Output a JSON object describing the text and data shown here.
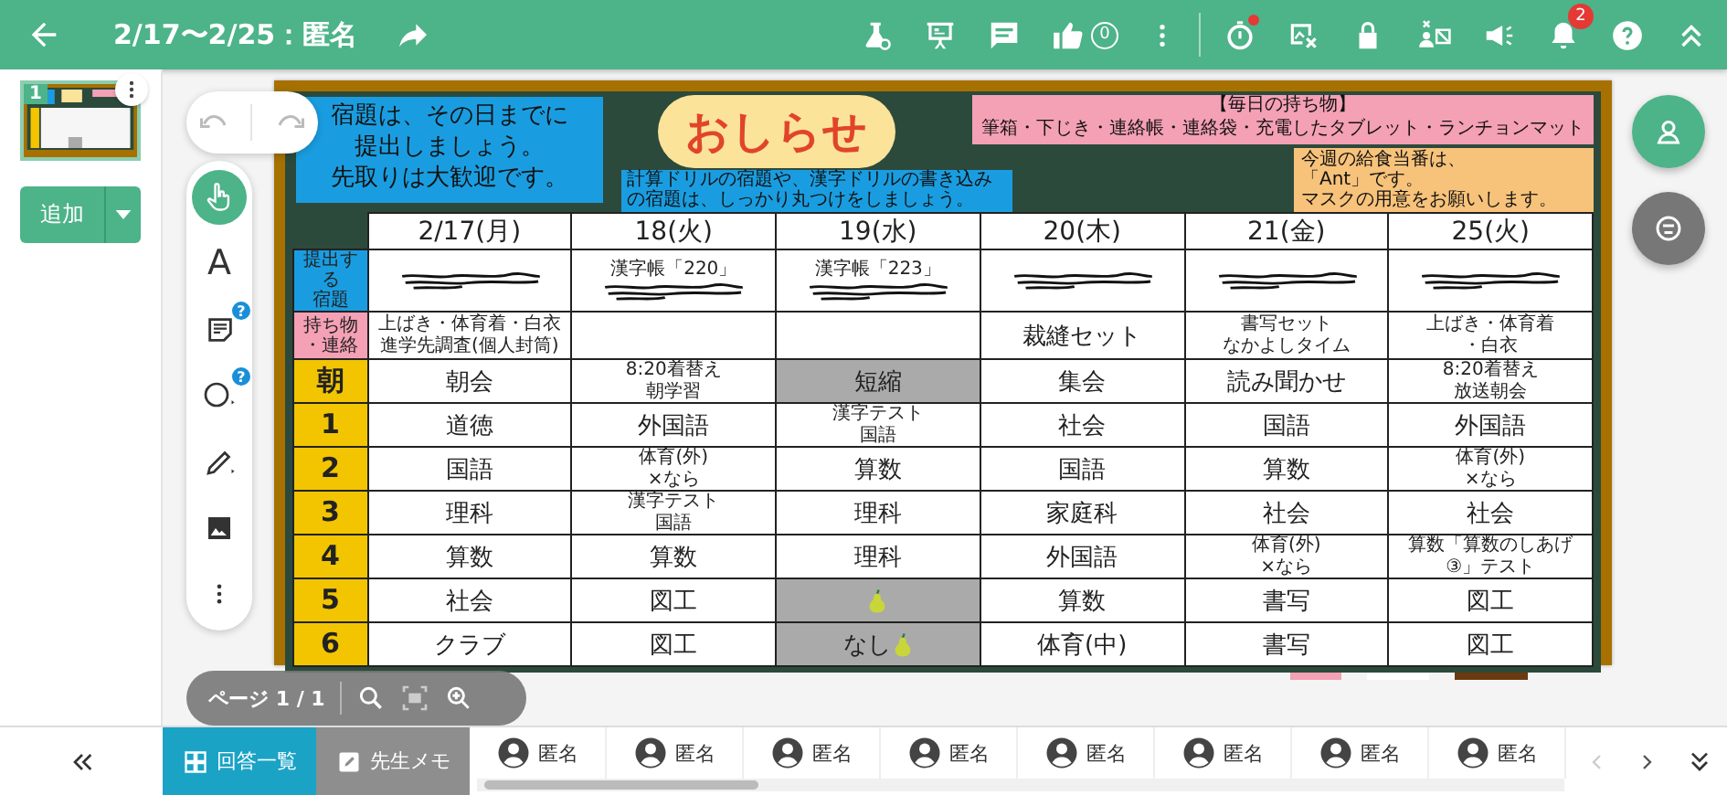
{
  "header": {
    "title": "2/17〜2/25：匿名",
    "likes": "0",
    "timer_alert": true,
    "notifications": "2"
  },
  "pages": [
    {
      "number": "1",
      "selected": true
    }
  ],
  "add_button": {
    "label": "追加"
  },
  "tools": [
    {
      "kind": "pointer",
      "selected": true
    },
    {
      "kind": "text",
      "label": "A",
      "selected": false
    },
    {
      "kind": "note",
      "badge": "?",
      "selected": false
    },
    {
      "kind": "shape",
      "badge": "?",
      "selected": false
    },
    {
      "kind": "pen",
      "selected": false
    },
    {
      "kind": "image",
      "selected": false
    },
    {
      "kind": "more",
      "selected": false
    }
  ],
  "page_indicator": "ページ 1 / 1",
  "slide": {
    "homework_note": [
      "宿題は、その日までに",
      "提出しましょう。",
      "先取りは大歓迎です。"
    ],
    "notice_title": "おしらせ",
    "drill_note": [
      "計算ドリルの宿題や、漢字ドリルの書き込み",
      "の宿題は、しっかり丸つけをしましょう。"
    ],
    "belongings_title": "【毎日の持ち物】",
    "belongings": "筆箱・下じき・連絡帳・連絡袋・充電したタブレット・ランチョンマット",
    "lunch_note": [
      "今週の給食当番は、",
      "「Ant」です。",
      "マスクの用意をお願いします。"
    ],
    "timetable": {
      "columns": [
        "2/17(月)",
        "18(火)",
        "19(水)",
        "20(木)",
        "21(金)",
        "25(火)"
      ],
      "rows": [
        {
          "kind": "submit",
          "label": [
            "提出する",
            "宿題"
          ],
          "cells": [
            {
              "redacted": true
            },
            {
              "lines": [
                "漢字帳「220」"
              ],
              "redacted": true
            },
            {
              "lines": [
                "漢字帳「223」"
              ],
              "redacted": true
            },
            {
              "redacted": true
            },
            {
              "redacted": true
            },
            {
              "redacted": true
            }
          ]
        },
        {
          "kind": "items",
          "label": [
            "持ち物",
            "・連絡"
          ],
          "cells": [
            {
              "lines": [
                "上ばき・体育着・白衣",
                "進学先調査(個人封筒)"
              ]
            },
            {},
            {},
            {
              "lines": [
                "裁縫セット"
              ]
            },
            {
              "lines": [
                "書写セット",
                "なかよしタイム"
              ]
            },
            {
              "lines": [
                "上ばき・体育着",
                "・白衣"
              ]
            }
          ]
        },
        {
          "kind": "period",
          "label": [
            "朝"
          ],
          "cells": [
            {
              "lines": [
                "朝会"
              ]
            },
            {
              "lines": [
                "8:20着替え",
                "朝学習"
              ]
            },
            {
              "lines": [
                "短縮"
              ],
              "shaded": true
            },
            {
              "lines": [
                "集会"
              ]
            },
            {
              "lines": [
                "読み聞かせ"
              ]
            },
            {
              "lines": [
                "8:20着替え",
                "放送朝会"
              ]
            }
          ]
        },
        {
          "kind": "period",
          "label": [
            "1"
          ],
          "cells": [
            {
              "lines": [
                "道徳"
              ]
            },
            {
              "lines": [
                "外国語"
              ]
            },
            {
              "lines": [
                "漢字テスト",
                "国語"
              ]
            },
            {
              "lines": [
                "社会"
              ]
            },
            {
              "lines": [
                "国語"
              ]
            },
            {
              "lines": [
                "外国語"
              ]
            }
          ]
        },
        {
          "kind": "period",
          "label": [
            "2"
          ],
          "cells": [
            {
              "lines": [
                "国語"
              ]
            },
            {
              "lines": [
                "体育(外)",
                "×なら"
              ]
            },
            {
              "lines": [
                "算数"
              ]
            },
            {
              "lines": [
                "国語"
              ]
            },
            {
              "lines": [
                "算数"
              ]
            },
            {
              "lines": [
                "体育(外)",
                "×なら"
              ]
            }
          ]
        },
        {
          "kind": "period",
          "label": [
            "3"
          ],
          "cells": [
            {
              "lines": [
                "理科"
              ]
            },
            {
              "lines": [
                "漢字テスト",
                "国語"
              ]
            },
            {
              "lines": [
                "理科"
              ]
            },
            {
              "lines": [
                "家庭科"
              ]
            },
            {
              "lines": [
                "社会"
              ]
            },
            {
              "lines": [
                "社会"
              ]
            }
          ]
        },
        {
          "kind": "period",
          "label": [
            "4"
          ],
          "cells": [
            {
              "lines": [
                "算数"
              ]
            },
            {
              "lines": [
                "算数"
              ]
            },
            {
              "lines": [
                "理科"
              ]
            },
            {
              "lines": [
                "外国語"
              ]
            },
            {
              "lines": [
                "体育(外)",
                "×なら"
              ]
            },
            {
              "lines": [
                "算数「算数のしあげ",
                "③」テスト"
              ]
            }
          ]
        },
        {
          "kind": "period",
          "label": [
            "5"
          ],
          "cells": [
            {
              "lines": [
                "社会"
              ]
            },
            {
              "lines": [
                "図工"
              ]
            },
            {
              "kind": "pear",
              "shaded": true
            },
            {
              "lines": [
                "算数"
              ]
            },
            {
              "lines": [
                "書写"
              ]
            },
            {
              "lines": [
                "図工"
              ]
            }
          ]
        },
        {
          "kind": "period",
          "label": [
            "6"
          ],
          "cells": [
            {
              "lines": [
                "クラブ"
              ]
            },
            {
              "lines": [
                "図工"
              ]
            },
            {
              "lines": [
                "なし"
              ],
              "kind": "pear",
              "shaded": true
            },
            {
              "lines": [
                "体育(中)"
              ]
            },
            {
              "lines": [
                "書写"
              ]
            },
            {
              "lines": [
                "図工"
              ]
            }
          ]
        }
      ]
    }
  },
  "bottom_tabs": [
    {
      "label": "回答一覧",
      "selected": true
    },
    {
      "label": "先生メモ",
      "selected": false
    }
  ],
  "students": [
    {
      "name": "匿名"
    },
    {
      "name": "匿名"
    },
    {
      "name": "匿名"
    },
    {
      "name": "匿名"
    },
    {
      "name": "匿名"
    },
    {
      "name": "匿名"
    },
    {
      "name": "匿名"
    },
    {
      "name": "匿名"
    }
  ]
}
